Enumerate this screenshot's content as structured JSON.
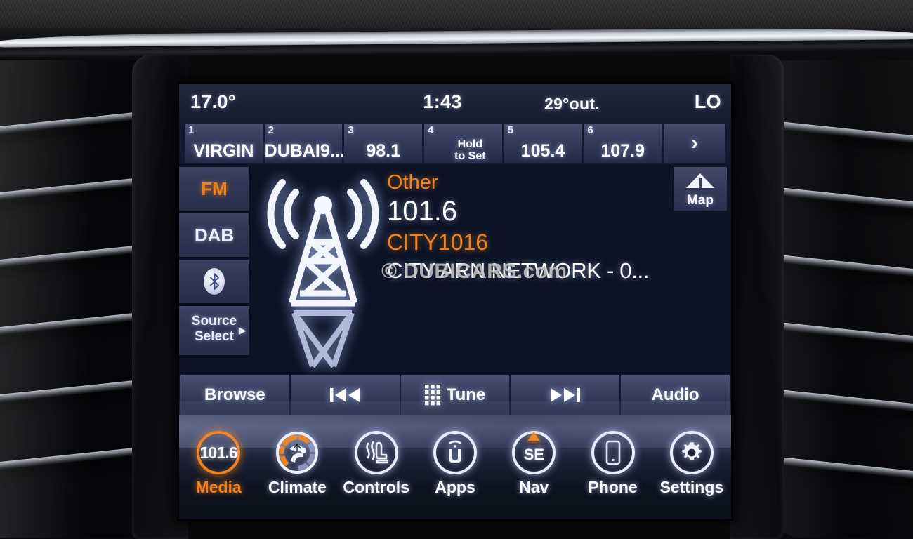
{
  "statusbar": {
    "cabin_temp": "17.0°",
    "clock": "1:43",
    "outside_temp": "29°out.",
    "fan_mode": "LO"
  },
  "presets": [
    {
      "num": "1",
      "value": "VIRGIN",
      "two_line": false
    },
    {
      "num": "2",
      "value": "DUBAI9...",
      "two_line": false
    },
    {
      "num": "3",
      "value": "98.1",
      "two_line": false
    },
    {
      "num": "4",
      "value": "Hold\nto Set",
      "two_line": true
    },
    {
      "num": "5",
      "value": "105.4",
      "two_line": false
    },
    {
      "num": "6",
      "value": "107.9",
      "two_line": false
    }
  ],
  "presets_next_label": "›",
  "source_rail": {
    "fm": "FM",
    "dab": "DAB",
    "bluetooth_icon": "bluetooth-icon",
    "source_select": "Source\nSelect",
    "source_select_line1": "Source",
    "source_select_line2": "Select",
    "source_select_arrow": "▶"
  },
  "map_button": {
    "label": "Map",
    "icon": "map-arrow-icon"
  },
  "now_playing": {
    "genre": "Other",
    "frequency": "101.6",
    "call_sign": "CITY1016",
    "radio_text": "CITY ARN NETWORK - 0...",
    "station_icon": "radio-tower-icon"
  },
  "watermark": "© DUBICARS.com",
  "transport": [
    {
      "label": "Browse",
      "icon": ""
    },
    {
      "label": "",
      "icon": "previous-track-icon"
    },
    {
      "label": "Tune",
      "icon": "keypad-icon"
    },
    {
      "label": "",
      "icon": "next-track-icon"
    },
    {
      "label": "Audio",
      "icon": ""
    }
  ],
  "nav": [
    {
      "label": "Media",
      "icon": "media-frequency-icon",
      "value": "101.6",
      "active": true
    },
    {
      "label": "Climate",
      "icon": "climate-fan-seat-icon",
      "active": false
    },
    {
      "label": "Controls",
      "icon": "heated-seat-icon",
      "active": false
    },
    {
      "label": "Apps",
      "icon": "uconnect-u-icon",
      "active": false
    },
    {
      "label": "Nav",
      "icon": "compass-se-icon",
      "value": "SE",
      "active": false
    },
    {
      "label": "Phone",
      "icon": "phone-icon",
      "active": false
    },
    {
      "label": "Settings",
      "icon": "gear-icon",
      "active": false
    }
  ],
  "colors": {
    "accent_orange": "#f0821e",
    "screen_bg": "#111a2e",
    "media_bg": "#0c1426",
    "button_blue": "#3c4566",
    "text_white": "#ffffff"
  }
}
